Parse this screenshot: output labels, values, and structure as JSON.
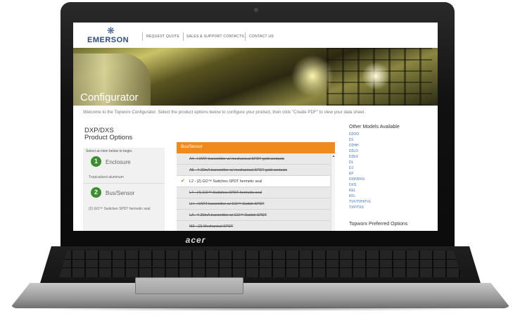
{
  "bezel": {
    "brand": "acer"
  },
  "header": {
    "logo": "EMERSON",
    "nav": [
      "REQUEST QUOTE",
      "SALES & SUPPORT CONTACTS",
      "CONTACT US"
    ]
  },
  "hero": {
    "title": "Configurator"
  },
  "welcome_text": "Welcome to the Topworx Configurator. Select the product options below to configure your product, then click \"Create PDF\" to view your data sheet.",
  "product": {
    "model": "DXP/DXS",
    "subtitle": "Product Options",
    "hint": "Select an item below to begin."
  },
  "steps": [
    {
      "number": "1",
      "label": "Enclosure",
      "note": "Tropicalized aluminum"
    },
    {
      "number": "2",
      "label": "Bus/Sensor",
      "note": "(2) GO™ Switches SPDT hermetic seal"
    }
  ],
  "dropdown": {
    "header": "Bus/Sensor",
    "options": [
      {
        "text": "A4 - HART transmitter w/ mechanical SPDT gold contacts",
        "selected": false
      },
      {
        "text": "A5 - 4-20mA transmitter w/ mechanical SPDT gold contacts",
        "selected": false
      },
      {
        "text": "L2 - (2) GO™ Switches SPDT hermetic seal",
        "selected": true
      },
      {
        "text": "L4 - (4) GO™ Switches SPDT hermetic seal",
        "selected": false
      },
      {
        "text": "LH - HART transmitter w/ GO™ Switch SPDT",
        "selected": false
      },
      {
        "text": "LA - 4-20mA transmitter w/ GO™ Switch SPDT",
        "selected": false
      },
      {
        "text": "M2 - (2) Mechanical SPDT",
        "selected": false
      }
    ]
  },
  "right": {
    "title": "Other Models Available",
    "models": [
      "D2OO",
      "D1",
      "D2HH",
      "D2LO",
      "D2EX",
      "DL",
      "DJ",
      "EF",
      "DXP/DXS",
      "DXS",
      "KEL",
      "KFL",
      "TVF/TVH/TVL",
      "TXP/TXS"
    ],
    "preferred_title": "Topworx Preferred Options"
  }
}
